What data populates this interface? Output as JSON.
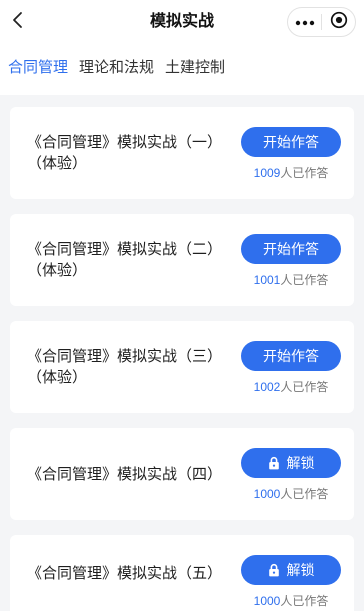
{
  "nav": {
    "title": "模拟实战",
    "back_icon": "chevron-left-icon",
    "more_icon": "more-dots-icon",
    "home_icon": "target-circle-icon"
  },
  "tabs": [
    {
      "label": "合同管理",
      "active": true
    },
    {
      "label": "理论和法规",
      "active": false
    },
    {
      "label": "土建控制",
      "active": false
    }
  ],
  "exams": [
    {
      "title": "《合同管理》模拟实战（一）",
      "tag": "（体验）",
      "button": "开始作答",
      "locked": false,
      "count": 1009,
      "count_suffix": "人已作答"
    },
    {
      "title": "《合同管理》模拟实战（二）",
      "tag": "（体验）",
      "button": "开始作答",
      "locked": false,
      "count": 1001,
      "count_suffix": "人已作答"
    },
    {
      "title": "《合同管理》模拟实战（三）",
      "tag": "（体验）",
      "button": "开始作答",
      "locked": false,
      "count": 1002,
      "count_suffix": "人已作答"
    },
    {
      "title": "《合同管理》模拟实战（四）",
      "button": "解锁",
      "locked": true,
      "lock_icon": "lock-icon",
      "count": 1000,
      "count_suffix": "人已作答"
    },
    {
      "title": "《合同管理》模拟实战（五）",
      "button": "解锁",
      "locked": true,
      "lock_icon": "lock-icon",
      "count": 1000,
      "count_suffix": "人已作答"
    }
  ],
  "colors": {
    "accent": "#2f6fed",
    "page_bg": "#f4f5f7",
    "card_bg": "#ffffff",
    "text": "#1f1f1f",
    "muted": "#777777"
  }
}
